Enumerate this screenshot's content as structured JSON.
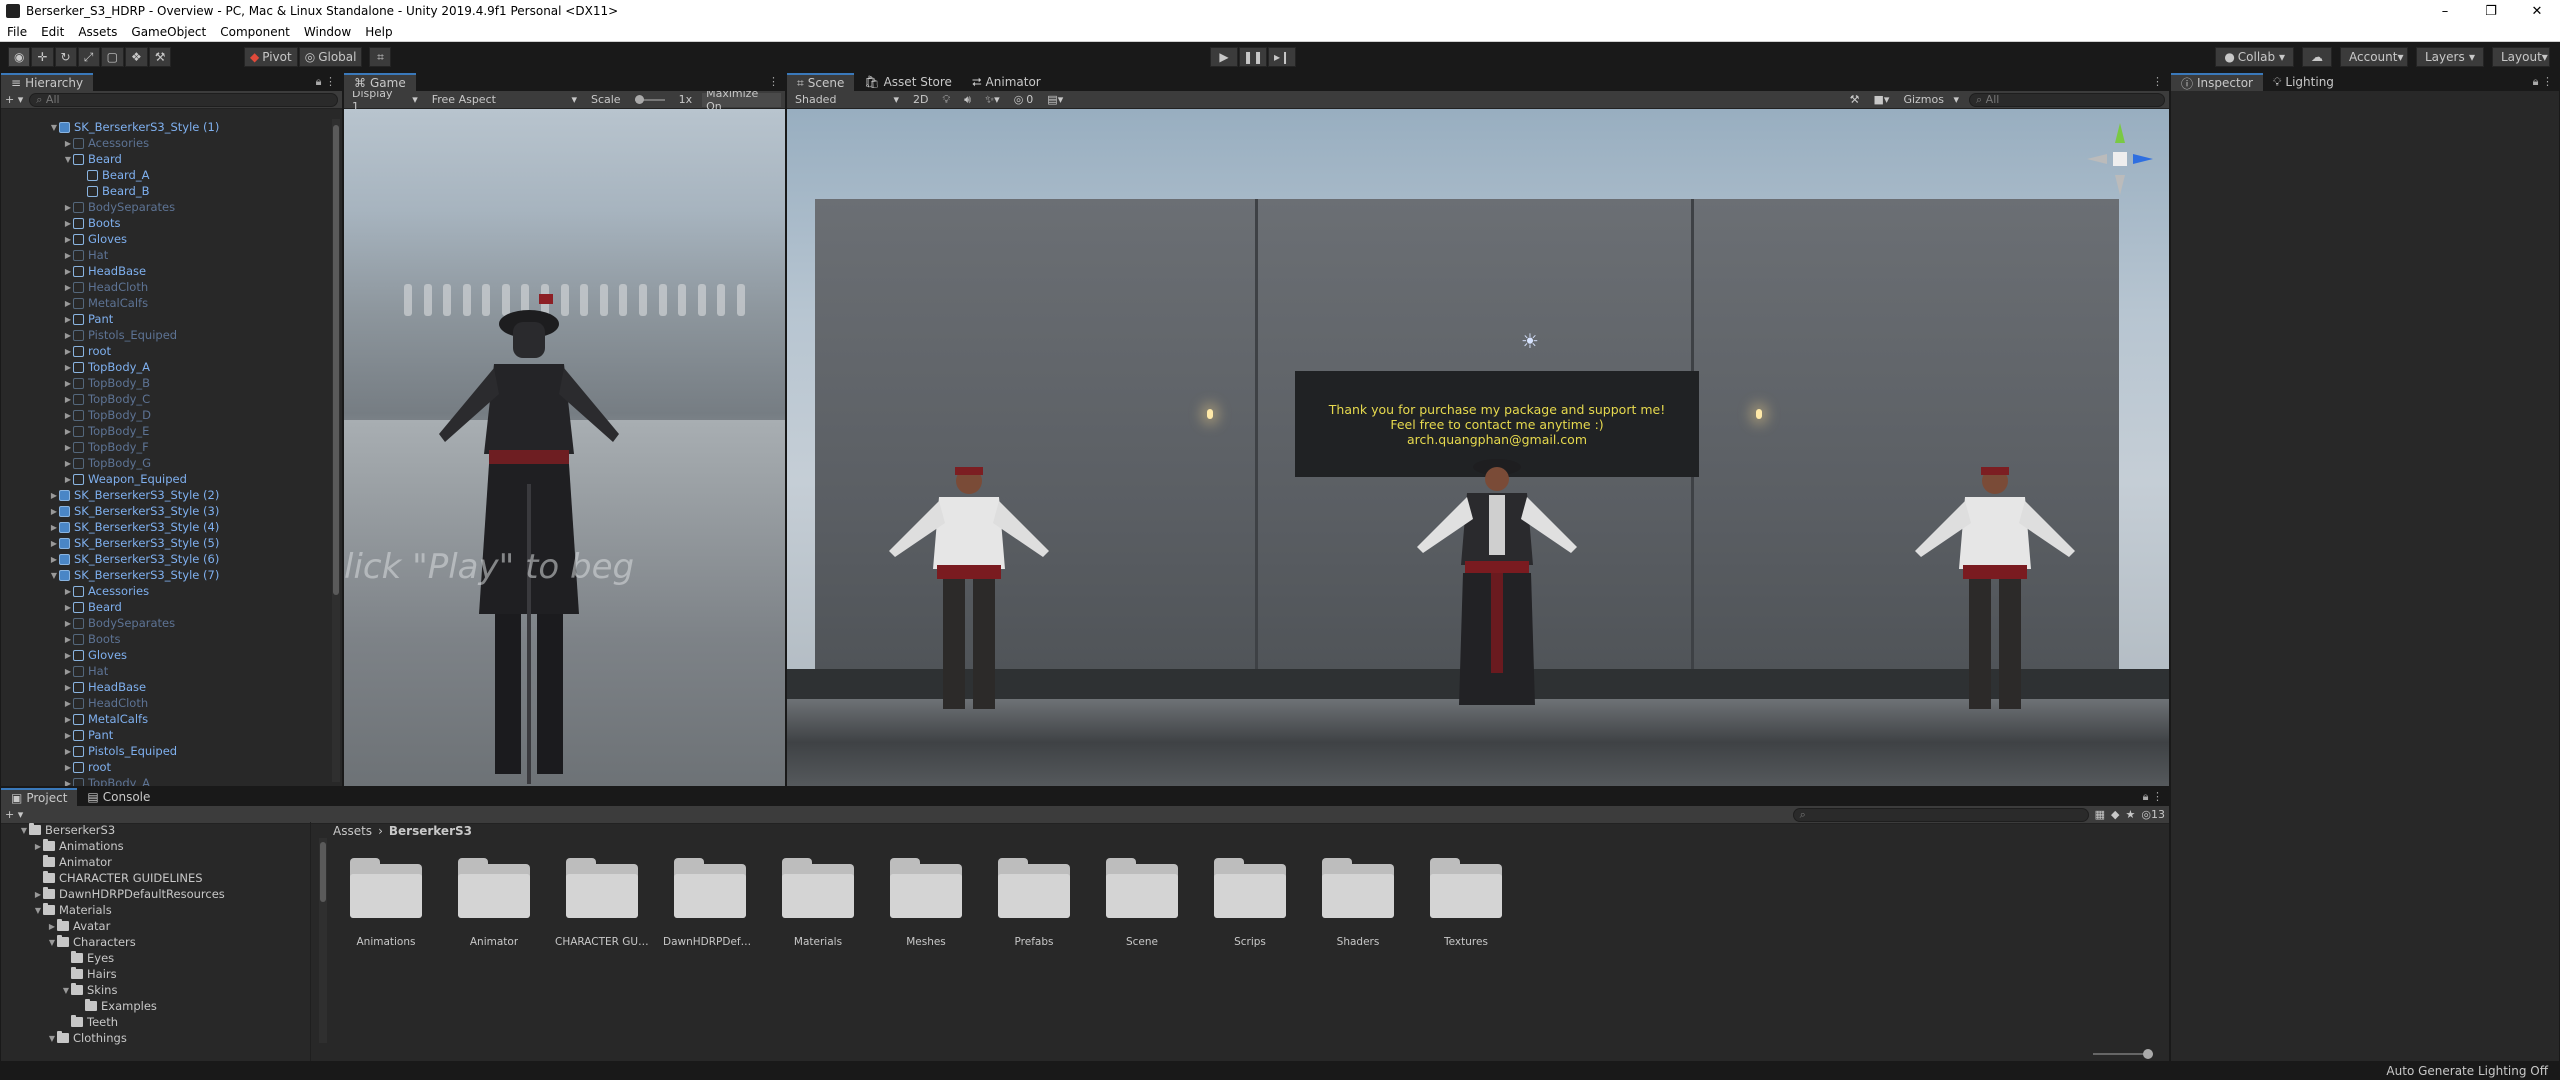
{
  "window": {
    "title": "Berserker_S3_HDRP - Overview - PC, Mac & Linux Standalone - Unity 2019.4.9f1 Personal <DX11>"
  },
  "menu": [
    "File",
    "Edit",
    "Assets",
    "GameObject",
    "Component",
    "Window",
    "Help"
  ],
  "toolbar": {
    "pivot": "Pivot",
    "global": "Global",
    "collab": "Collab",
    "account": "Account",
    "layers": "Layers",
    "layout": "Layout"
  },
  "hierarchy": {
    "tab": "Hierarchy",
    "search_placeholder": "All",
    "rows": [
      {
        "label": "SK_BerserkerS3_Style (1)",
        "indent": 1,
        "state": "open",
        "style": "blue",
        "root": true
      },
      {
        "label": "Acessories",
        "indent": 2,
        "state": "closed",
        "style": "dim"
      },
      {
        "label": "Beard",
        "indent": 2,
        "state": "open",
        "style": "blue"
      },
      {
        "label": "Beard_A",
        "indent": 3,
        "state": "none",
        "style": "blue"
      },
      {
        "label": "Beard_B",
        "indent": 3,
        "state": "none",
        "style": "blue"
      },
      {
        "label": "BodySeparates",
        "indent": 2,
        "state": "closed",
        "style": "dim"
      },
      {
        "label": "Boots",
        "indent": 2,
        "state": "closed",
        "style": "blue"
      },
      {
        "label": "Gloves",
        "indent": 2,
        "state": "closed",
        "style": "blue"
      },
      {
        "label": "Hat",
        "indent": 2,
        "state": "closed",
        "style": "dim"
      },
      {
        "label": "HeadBase",
        "indent": 2,
        "state": "closed",
        "style": "blue"
      },
      {
        "label": "HeadCloth",
        "indent": 2,
        "state": "closed",
        "style": "dim"
      },
      {
        "label": "MetalCalfs",
        "indent": 2,
        "state": "closed",
        "style": "dim"
      },
      {
        "label": "Pant",
        "indent": 2,
        "state": "closed",
        "style": "blue"
      },
      {
        "label": "Pistols_Equiped",
        "indent": 2,
        "state": "closed",
        "style": "dim"
      },
      {
        "label": "root",
        "indent": 2,
        "state": "closed",
        "style": "blue"
      },
      {
        "label": "TopBody_A",
        "indent": 2,
        "state": "closed",
        "style": "blue"
      },
      {
        "label": "TopBody_B",
        "indent": 2,
        "state": "closed",
        "style": "dim"
      },
      {
        "label": "TopBody_C",
        "indent": 2,
        "state": "closed",
        "style": "dim"
      },
      {
        "label": "TopBody_D",
        "indent": 2,
        "state": "closed",
        "style": "dim"
      },
      {
        "label": "TopBody_E",
        "indent": 2,
        "state": "closed",
        "style": "dim"
      },
      {
        "label": "TopBody_F",
        "indent": 2,
        "state": "closed",
        "style": "dim"
      },
      {
        "label": "TopBody_G",
        "indent": 2,
        "state": "closed",
        "style": "dim"
      },
      {
        "label": "Weapon_Equiped",
        "indent": 2,
        "state": "closed",
        "style": "blue"
      },
      {
        "label": "SK_BerserkerS3_Style (2)",
        "indent": 1,
        "state": "closed",
        "style": "blue",
        "root": true
      },
      {
        "label": "SK_BerserkerS3_Style (3)",
        "indent": 1,
        "state": "closed",
        "style": "blue",
        "root": true
      },
      {
        "label": "SK_BerserkerS3_Style (4)",
        "indent": 1,
        "state": "closed",
        "style": "blue",
        "root": true
      },
      {
        "label": "SK_BerserkerS3_Style (5)",
        "indent": 1,
        "state": "closed",
        "style": "blue",
        "root": true
      },
      {
        "label": "SK_BerserkerS3_Style (6)",
        "indent": 1,
        "state": "closed",
        "style": "blue",
        "root": true
      },
      {
        "label": "SK_BerserkerS3_Style (7)",
        "indent": 1,
        "state": "open",
        "style": "blue",
        "root": true
      },
      {
        "label": "Acessories",
        "indent": 2,
        "state": "closed",
        "style": "blue"
      },
      {
        "label": "Beard",
        "indent": 2,
        "state": "closed",
        "style": "blue"
      },
      {
        "label": "BodySeparates",
        "indent": 2,
        "state": "closed",
        "style": "dim"
      },
      {
        "label": "Boots",
        "indent": 2,
        "state": "closed",
        "style": "dim"
      },
      {
        "label": "Gloves",
        "indent": 2,
        "state": "closed",
        "style": "blue"
      },
      {
        "label": "Hat",
        "indent": 2,
        "state": "closed",
        "style": "dim"
      },
      {
        "label": "HeadBase",
        "indent": 2,
        "state": "closed",
        "style": "blue"
      },
      {
        "label": "HeadCloth",
        "indent": 2,
        "state": "closed",
        "style": "dim"
      },
      {
        "label": "MetalCalfs",
        "indent": 2,
        "state": "closed",
        "style": "blue"
      },
      {
        "label": "Pant",
        "indent": 2,
        "state": "closed",
        "style": "blue"
      },
      {
        "label": "Pistols_Equiped",
        "indent": 2,
        "state": "closed",
        "style": "blue"
      },
      {
        "label": "root",
        "indent": 2,
        "state": "closed",
        "style": "blue"
      },
      {
        "label": "TopBody_A",
        "indent": 2,
        "state": "closed",
        "style": "dim"
      }
    ]
  },
  "game": {
    "tab": "Game",
    "display": "Display 1",
    "aspect": "Free Aspect",
    "scale_label": "Scale",
    "scale_value": "1x",
    "maximize": "Maximize On",
    "overlay_text": "lick \"Play\" to beg"
  },
  "scene": {
    "tabs": [
      "Scene",
      "Asset Store",
      "Animator"
    ],
    "shading": "Shaded",
    "mode2d": "2D",
    "fx_count": "0",
    "gizmos": "Gizmos",
    "search_placeholder": "All",
    "panel_lines": [
      "Thank you for purchase my package and support me!",
      "Feel free to contact me anytime :)",
      "arch.quangphan@gmail.com"
    ]
  },
  "inspector": {
    "tabs": [
      "Inspector",
      "Lighting"
    ]
  },
  "project": {
    "tabs": [
      "Project",
      "Console"
    ],
    "hidden_count": "13",
    "tree": [
      {
        "label": "BerserkerS3",
        "indent": 0,
        "state": "open"
      },
      {
        "label": "Animations",
        "indent": 1,
        "state": "closed"
      },
      {
        "label": "Animator",
        "indent": 1,
        "state": "none"
      },
      {
        "label": "CHARACTER GUIDELINES",
        "indent": 1,
        "state": "none"
      },
      {
        "label": "DawnHDRPDefaultResources",
        "indent": 1,
        "state": "closed"
      },
      {
        "label": "Materials",
        "indent": 1,
        "state": "open"
      },
      {
        "label": "Avatar",
        "indent": 2,
        "state": "closed"
      },
      {
        "label": "Characters",
        "indent": 2,
        "state": "open"
      },
      {
        "label": "Eyes",
        "indent": 3,
        "state": "none"
      },
      {
        "label": "Hairs",
        "indent": 3,
        "state": "none"
      },
      {
        "label": "Skins",
        "indent": 3,
        "state": "open"
      },
      {
        "label": "Examples",
        "indent": 4,
        "state": "none"
      },
      {
        "label": "Teeth",
        "indent": 3,
        "state": "none"
      },
      {
        "label": "Clothings",
        "indent": 2,
        "state": "open"
      }
    ],
    "breadcrumb": [
      "Assets",
      "BerserkerS3"
    ],
    "folders": [
      "Animations",
      "Animator",
      "CHARACTER GUI...",
      "DawnHDRPDefaul...",
      "Materials",
      "Meshes",
      "Prefabs",
      "Scene",
      "Scrips",
      "Shaders",
      "Textures"
    ]
  },
  "status": {
    "text": "Auto Generate Lighting Off"
  },
  "colors": {
    "accent": "#3a79bb",
    "link_blue": "#7fb0ef",
    "panel": "#282828",
    "notice": "#e6d94e"
  }
}
